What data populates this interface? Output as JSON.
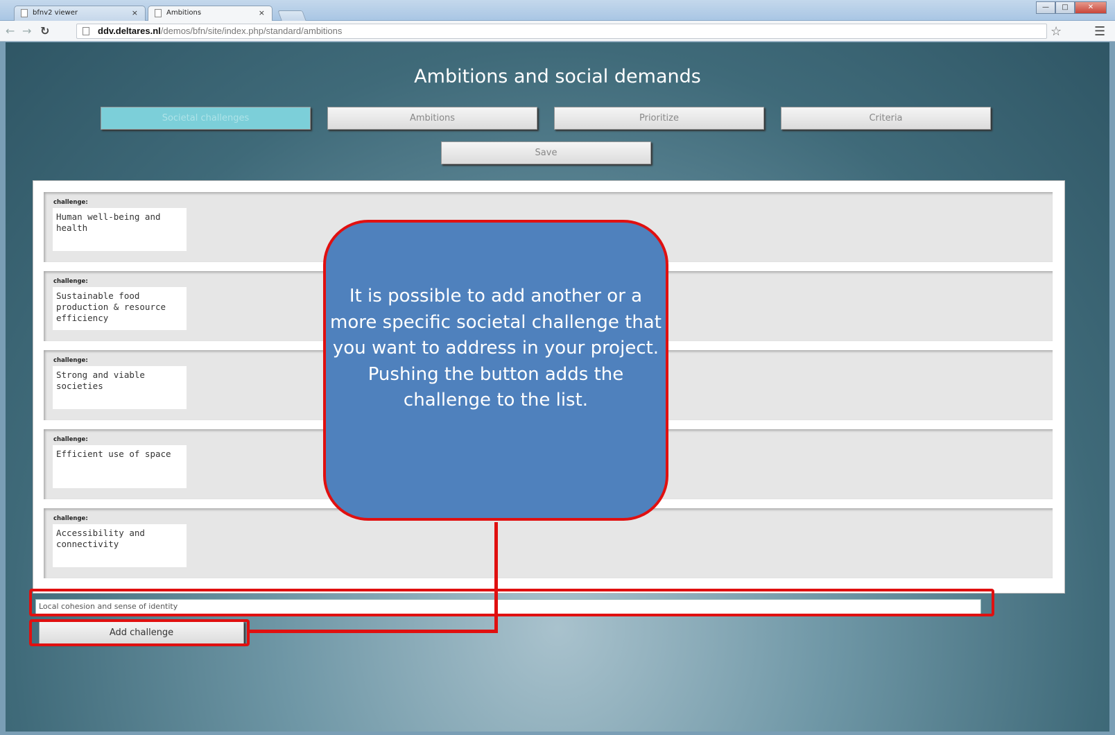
{
  "browser": {
    "tabs": [
      {
        "title": "bfnv2 viewer",
        "close": "×"
      },
      {
        "title": "Ambitions",
        "close": "×"
      }
    ],
    "url_host": "ddv.deltares.nl",
    "url_path": "/demos/bfn/site/index.php/standard/ambitions"
  },
  "page": {
    "title": "Ambitions and social demands",
    "nav": [
      "Societal challenges",
      "Ambitions",
      "Prioritize",
      "Criteria"
    ],
    "save_label": "Save",
    "challenge_label": "challenge:",
    "challenges": [
      "Human well-being and health",
      "Sustainable food production & resource efficiency",
      "Strong and viable societies",
      "Efficient use of space",
      "Accessibility and connectivity"
    ],
    "new_challenge_value": "Local cohesion and sense of identity",
    "add_button_label": "Add challenge"
  },
  "annotation": {
    "text": "It is possible to add another or a more specific societal challenge that you want to address  in your project. Pushing the button adds the challenge to the list.",
    "color": "#e01010",
    "fill": "#4f81bd"
  }
}
